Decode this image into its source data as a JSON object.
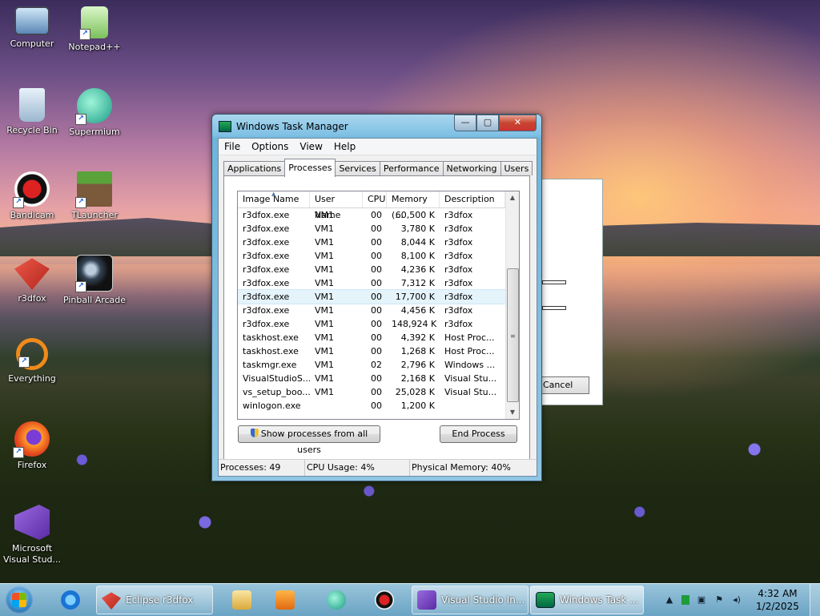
{
  "desktop": {
    "icons": [
      {
        "label": "Computer"
      },
      {
        "label": "Notepad++"
      },
      {
        "label": "Recycle Bin"
      },
      {
        "label": "Supermium"
      },
      {
        "label": "Bandicam"
      },
      {
        "label": "TLauncher"
      },
      {
        "label": "r3dfox"
      },
      {
        "label": "Pinball Arcade"
      },
      {
        "label": "Everything"
      },
      {
        "label": "Firefox"
      },
      {
        "label": "Microsoft Visual Stud..."
      }
    ]
  },
  "background_dialog": {
    "cancel_label": "Cancel"
  },
  "task_manager": {
    "title": "Windows Task Manager",
    "controls": {
      "minimize": "—",
      "maximize": "▢",
      "close": "✕"
    },
    "menu": [
      "File",
      "Options",
      "View",
      "Help"
    ],
    "tabs": [
      "Applications",
      "Processes",
      "Services",
      "Performance",
      "Networking",
      "Users"
    ],
    "active_tab": "Processes",
    "columns": [
      "Image Name",
      "User Name",
      "CPU",
      "Memory (...",
      "Description"
    ],
    "rows": [
      [
        "r3dfox.exe",
        "VM1",
        "00",
        "60,500 K",
        "r3dfox"
      ],
      [
        "r3dfox.exe",
        "VM1",
        "00",
        "3,780 K",
        "r3dfox"
      ],
      [
        "r3dfox.exe",
        "VM1",
        "00",
        "8,044 K",
        "r3dfox"
      ],
      [
        "r3dfox.exe",
        "VM1",
        "00",
        "8,100 K",
        "r3dfox"
      ],
      [
        "r3dfox.exe",
        "VM1",
        "00",
        "4,236 K",
        "r3dfox"
      ],
      [
        "r3dfox.exe",
        "VM1",
        "00",
        "7,312 K",
        "r3dfox"
      ],
      [
        "r3dfox.exe",
        "VM1",
        "00",
        "17,700 K",
        "r3dfox"
      ],
      [
        "r3dfox.exe",
        "VM1",
        "00",
        "4,456 K",
        "r3dfox"
      ],
      [
        "r3dfox.exe",
        "VM1",
        "00",
        "148,924 K",
        "r3dfox"
      ],
      [
        "taskhost.exe",
        "VM1",
        "00",
        "4,392 K",
        "Host Proc..."
      ],
      [
        "taskhost.exe",
        "VM1",
        "00",
        "1,268 K",
        "Host Proc..."
      ],
      [
        "taskmgr.exe",
        "VM1",
        "02",
        "2,796 K",
        "Windows ..."
      ],
      [
        "VisualStudioS...",
        "VM1",
        "00",
        "2,168 K",
        "Visual Stu..."
      ],
      [
        "vs_setup_boo...",
        "VM1",
        "00",
        "25,028 K",
        "Visual Stu..."
      ],
      [
        "winlogon.exe",
        "",
        "00",
        "1,200 K",
        ""
      ]
    ],
    "selected_row": 6,
    "show_all_label": "Show processes from all users",
    "end_process_label": "End Process",
    "status": {
      "processes": "Processes: 49",
      "cpu": "CPU Usage: 4%",
      "memory": "Physical Memory: 40%"
    }
  },
  "taskbar": {
    "items": [
      {
        "label": "Eclipse r3dfox",
        "icon": "r3dfox-icon"
      },
      {
        "label": "Visual Studio In...",
        "icon": "visual-studio-icon"
      },
      {
        "label": "Windows Task ...",
        "icon": "task-manager-icon"
      }
    ],
    "pinned": [
      "internet-explorer-icon",
      "file-explorer-icon",
      "media-player-icon",
      "supermium-icon",
      "bandicam-icon"
    ],
    "clock": {
      "time": "4:32 AM",
      "date": "1/2/2025"
    }
  }
}
